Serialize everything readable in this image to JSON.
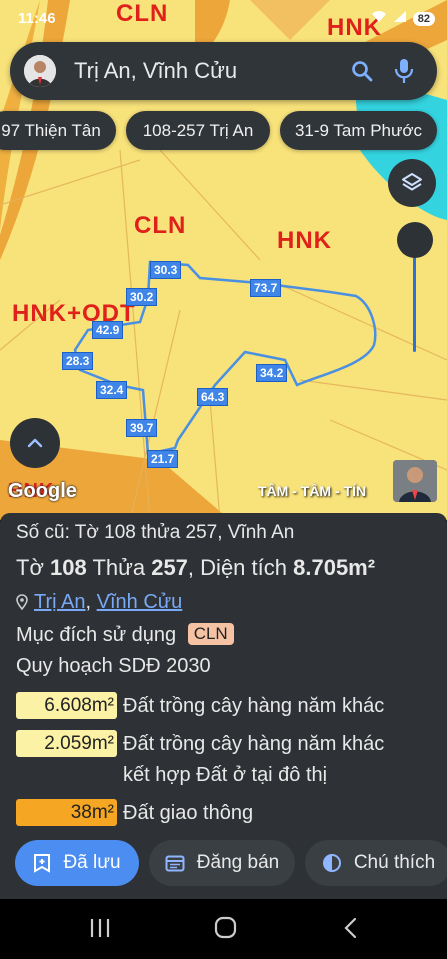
{
  "status_bar": {
    "time": "11:46",
    "battery": "82"
  },
  "search": {
    "query": "Trị An, Vĩnh Cửu"
  },
  "chips": [
    "97 Thiện Tân",
    "108-257 Trị An",
    "31-9 Tam Phước"
  ],
  "map": {
    "zone_labels": [
      "CLN",
      "HNK",
      "CLN",
      "HNK",
      "HNK+ODT",
      "HNK"
    ],
    "segment_lengths": [
      "30.3",
      "30.2",
      "73.7",
      "42.9",
      "28.3",
      "32.4",
      "34.2",
      "64.3",
      "39.7",
      "21.7"
    ],
    "attribution": "Google",
    "watermark": "TÂM - TẦM - TÍN"
  },
  "parcel": {
    "old_label": "Số cũ: Tờ 108 thửa 257, Vĩnh An",
    "sheet_label": "Tờ",
    "sheet": "108",
    "plot_label": "Thửa",
    "plot": "257",
    "area_label": "Diện tích",
    "area": "8.705m²",
    "commune": "Trị An",
    "district": "Vĩnh Cửu",
    "purpose_label": "Mục đích sử dụng",
    "purpose": "CLN",
    "plan_label": "Quy hoạch SDĐ 2030",
    "plans": [
      {
        "area": "6.608m²",
        "desc": "Đất trồng cây hàng năm khác",
        "color": "#fbf2a6"
      },
      {
        "area": "2.059m²",
        "desc": "Đất trồng cây hàng năm khác",
        "desc2": "kết hợp Đất ở tại đô thị",
        "color": "#fbf2a6"
      },
      {
        "area": "38m²",
        "desc": "Đất giao thông",
        "color": "#f5a623"
      }
    ]
  },
  "actions": {
    "saved": "Đã lưu",
    "sell": "Đăng bán",
    "legend": "Chú thích"
  },
  "colors": {
    "map_bg": "#f8e27a",
    "panel": "#2e3236",
    "accent": "#3b7fe0",
    "parcel_line": "#4a90e2",
    "zone_text": "#e0201a"
  }
}
